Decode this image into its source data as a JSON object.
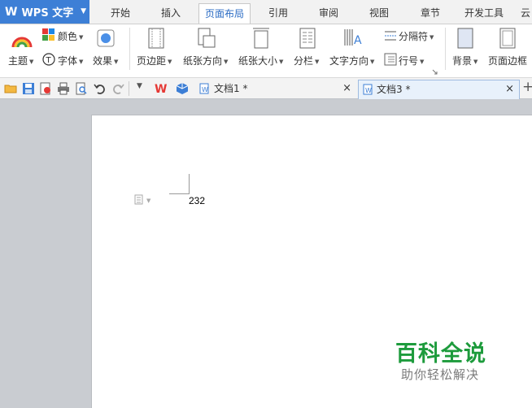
{
  "app": {
    "title": "WPS 文字"
  },
  "menu": {
    "tabs": [
      "开始",
      "插入",
      "页面布局",
      "引用",
      "审阅",
      "视图",
      "章节",
      "开发工具",
      "云"
    ],
    "active": "页面布局"
  },
  "ribbon": {
    "theme": "主题",
    "color": "颜色",
    "font": "字体",
    "effect": "效果",
    "margin": "页边距",
    "orientation": "纸张方向",
    "size": "纸张大小",
    "columns": "分栏",
    "text_direction": "文字方向",
    "separator": "分隔符",
    "line_number": "行号",
    "background": "背景",
    "page_border": "页面边框"
  },
  "doc_tabs": [
    {
      "label": "文档1 *",
      "active": false
    },
    {
      "label": "文档3 *",
      "active": true
    }
  ],
  "document": {
    "content": "232"
  },
  "watermark": {
    "title": "百科全说",
    "subtitle": "助你轻松解决"
  },
  "colors": {
    "accent": "#3d7fd6",
    "brand_green": "#1d9b3c",
    "active_tab_text": "#2b6cc4"
  }
}
